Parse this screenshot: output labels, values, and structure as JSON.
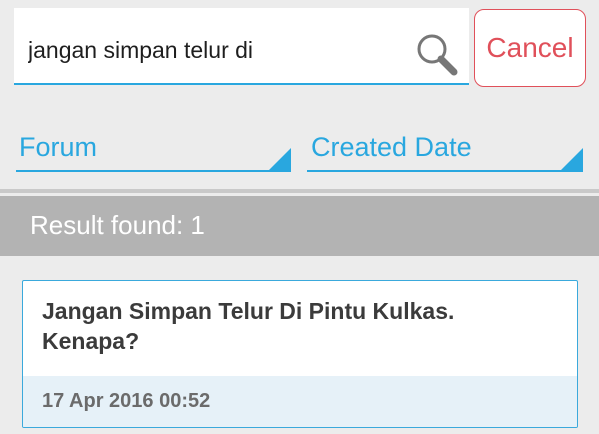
{
  "search": {
    "value": "jangan simpan telur di",
    "icon": "search-icon",
    "cancel_label": "Cancel"
  },
  "filters": {
    "forum_label": "Forum",
    "date_label": "Created Date"
  },
  "results": {
    "summary": "Result found: 1",
    "items": [
      {
        "title": "Jangan Simpan Telur Di Pintu Kulkas. Kenapa?",
        "date": "17 Apr 2016 00:52"
      }
    ]
  },
  "colors": {
    "accent": "#29a7df",
    "cancel": "#e0505a",
    "banner": "#b3b3b3",
    "background": "#ececec"
  }
}
